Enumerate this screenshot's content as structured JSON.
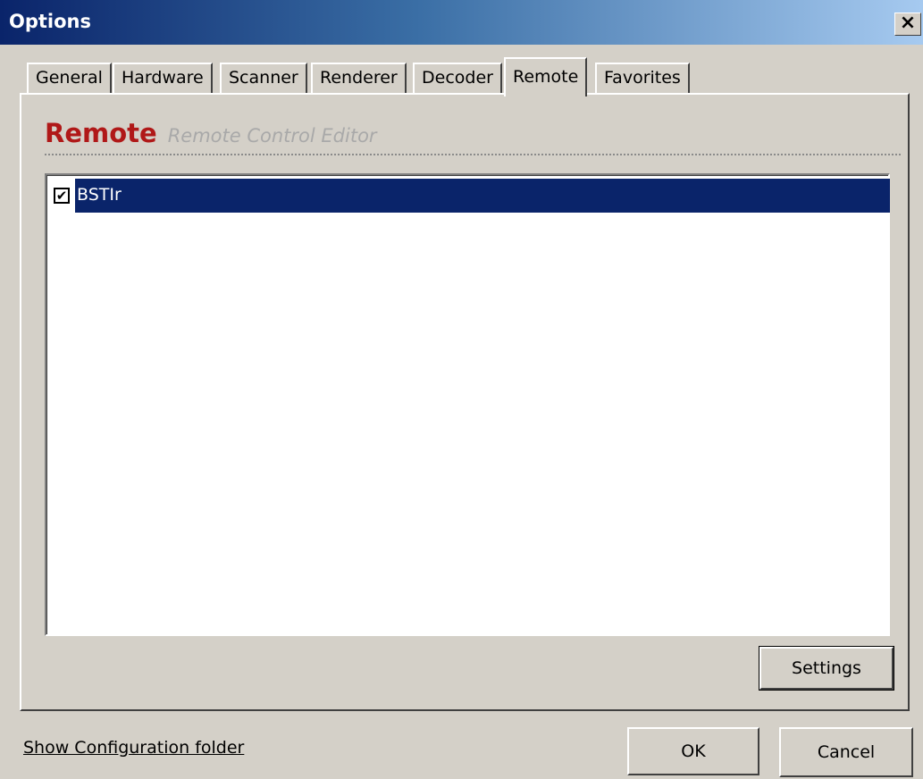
{
  "window": {
    "title": "Options",
    "close_glyph": "×"
  },
  "tabs": [
    {
      "label": "General"
    },
    {
      "label": "Hardware"
    },
    {
      "label": "Scanner"
    },
    {
      "label": "Renderer"
    },
    {
      "label": "Decoder"
    },
    {
      "label": "Remote",
      "active": true
    },
    {
      "label": "Favorites"
    }
  ],
  "panel": {
    "heading": "Remote",
    "subheading": "Remote Control Editor",
    "list_items": [
      {
        "label": "BSTIr",
        "checked": true,
        "selected": true
      }
    ],
    "settings_label": "Settings"
  },
  "footer": {
    "link_label": "Show Configuration folder",
    "ok_label": "OK",
    "cancel_label": "Cancel"
  },
  "colors": {
    "title_gradient_start": "#0a246a",
    "heading_red": "#b01818",
    "selection": "#0a246a",
    "face": "#d4d0c8"
  },
  "icons": {
    "close": "close-icon",
    "check": "checkmark-icon"
  }
}
